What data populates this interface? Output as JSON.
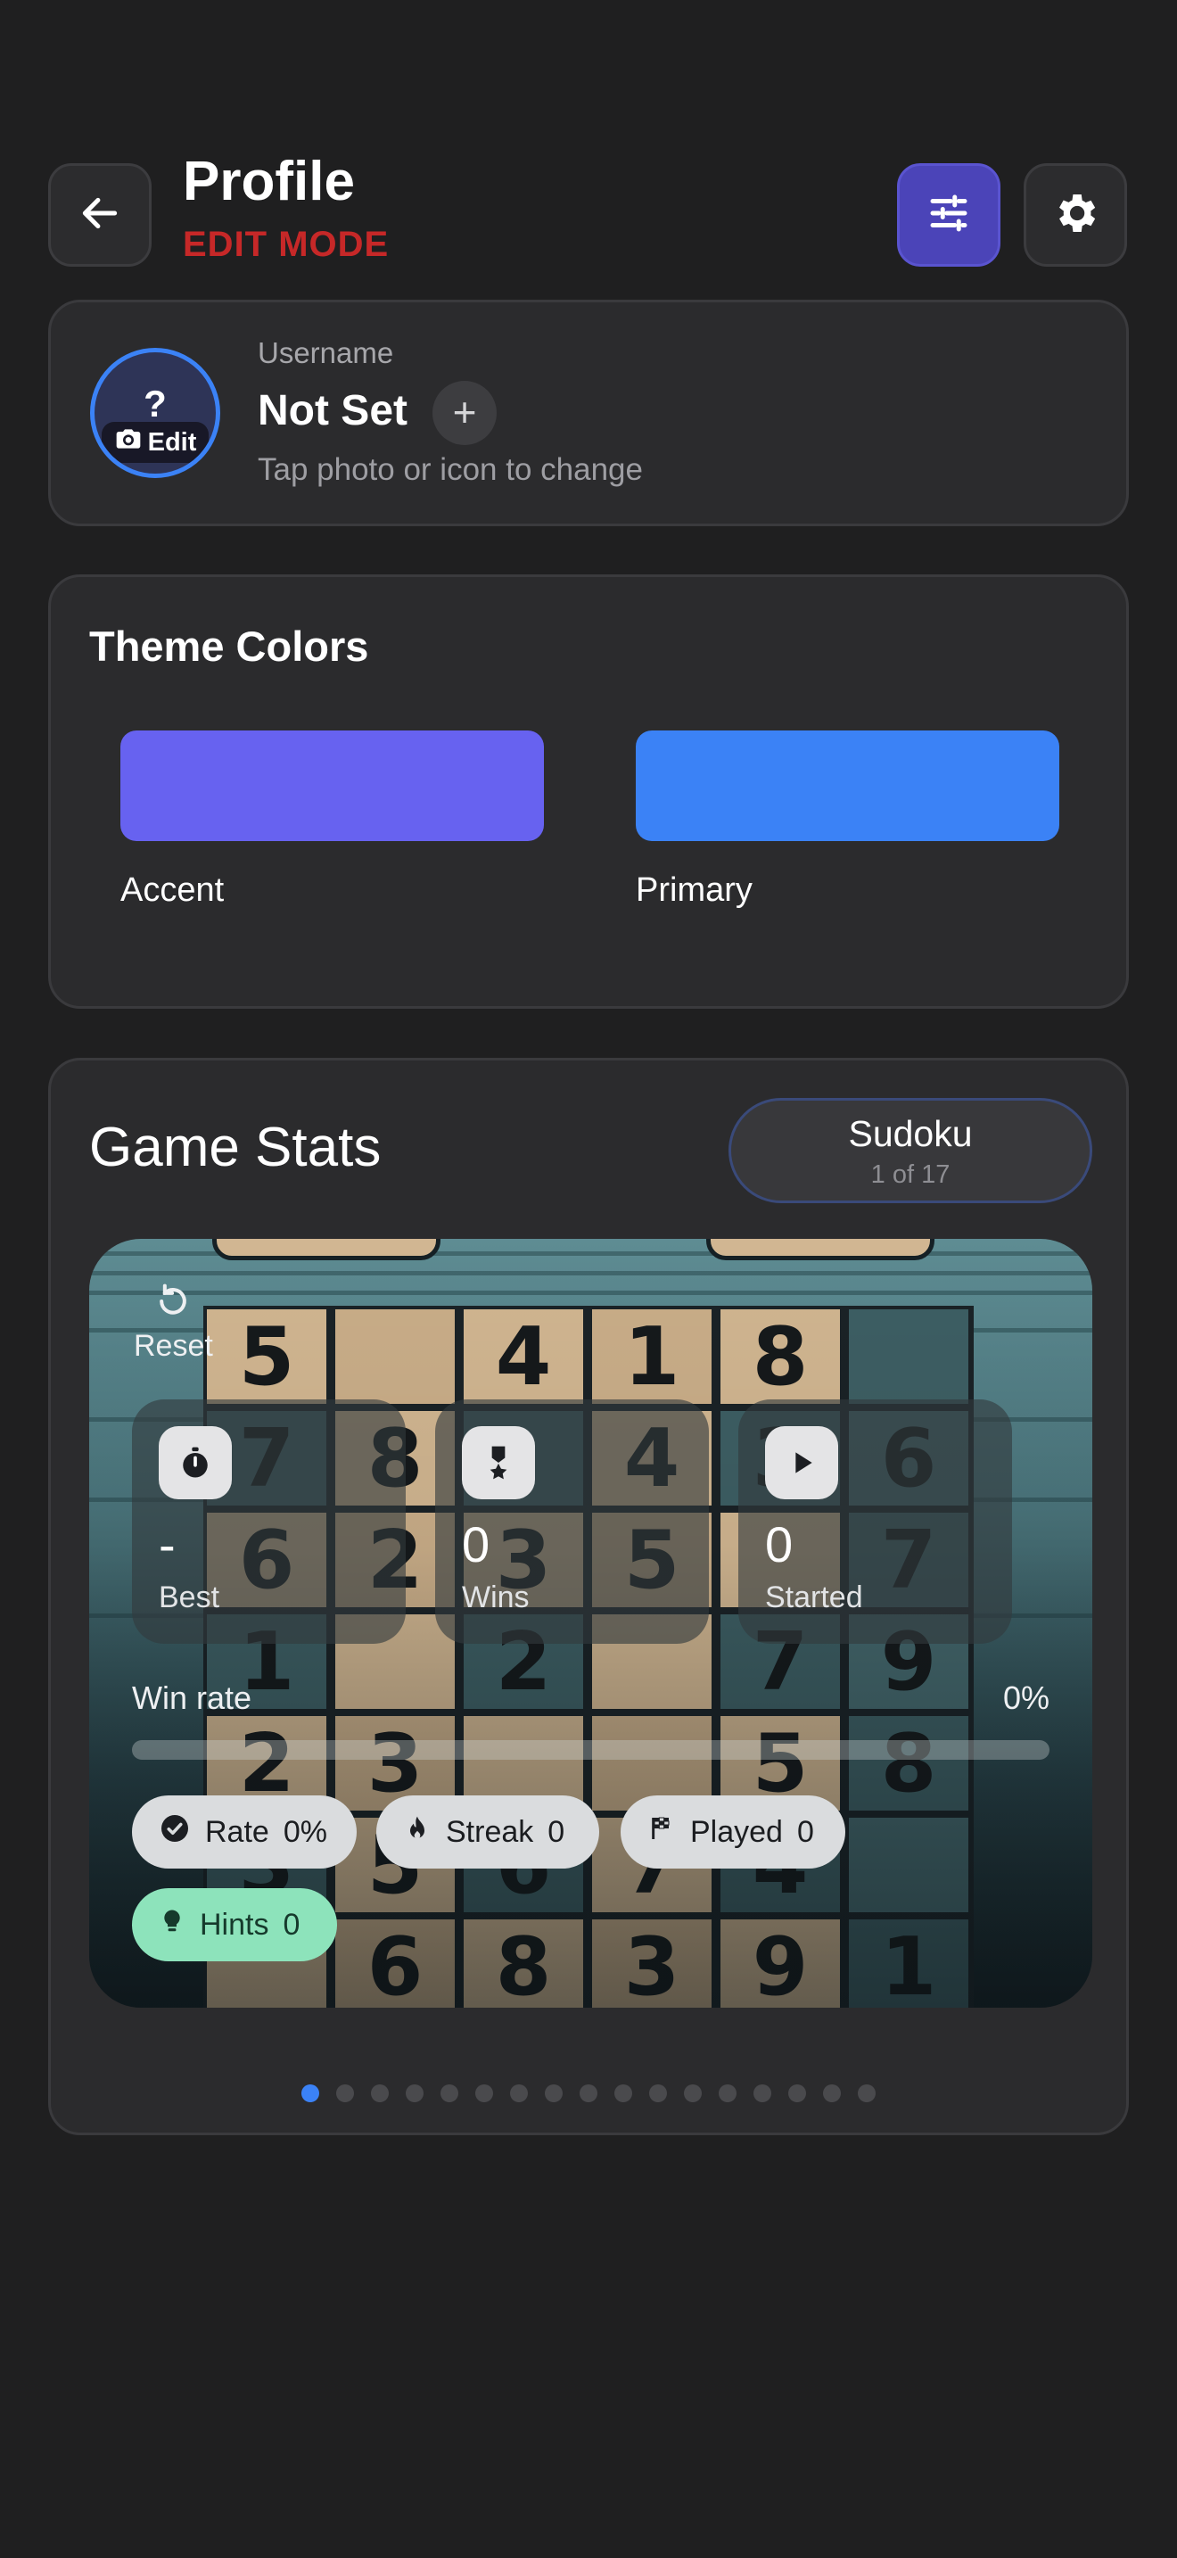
{
  "header": {
    "title": "Profile",
    "mode": "EDIT MODE",
    "back_icon": "arrow-left-icon",
    "tune_icon": "sliders-icon",
    "settings_icon": "gear-icon"
  },
  "profile": {
    "avatar_placeholder": "?",
    "avatar_edit_label": "Edit",
    "username_label": "Username",
    "username_value": "Not Set",
    "add_label": "+",
    "hint": "Tap photo or icon to change"
  },
  "theme": {
    "title": "Theme Colors",
    "swatches": [
      {
        "label": "Accent",
        "color": "#6762f0"
      },
      {
        "label": "Primary",
        "color": "#3b82f6"
      }
    ]
  },
  "game_stats": {
    "title": "Game Stats",
    "game_name": "Sudoku",
    "game_counter": "1 of 17",
    "reset_label": "Reset",
    "stats": [
      {
        "icon": "stopwatch-icon",
        "value": "-",
        "label": "Best"
      },
      {
        "icon": "medal-icon",
        "value": "0",
        "label": "Wins"
      },
      {
        "icon": "play-icon",
        "value": "0",
        "label": "Started"
      }
    ],
    "win_rate_label": "Win rate",
    "win_rate_value": "0%",
    "win_rate_fraction": 0,
    "chips": [
      {
        "icon": "check-circle-icon",
        "label": "Rate",
        "value": "0%"
      },
      {
        "icon": "flame-icon",
        "label": "Streak",
        "value": "0"
      },
      {
        "icon": "flag-icon",
        "label": "Played",
        "value": "0"
      },
      {
        "icon": "lightbulb-icon",
        "label": "Hints",
        "value": "0"
      }
    ],
    "board_rows": [
      [
        "5",
        "",
        "4",
        "1",
        "8",
        ""
      ],
      [
        "7",
        "8",
        "",
        "4",
        "3",
        "6"
      ],
      [
        "6",
        "2",
        "3",
        "5",
        "",
        "7"
      ],
      [
        "1",
        "",
        "2",
        "",
        "7",
        "9"
      ],
      [
        "2",
        "3",
        "",
        "",
        "5",
        "8"
      ],
      [
        "3",
        "5",
        "6",
        "7",
        "4",
        ""
      ],
      [
        "",
        "6",
        "8",
        "3",
        "9",
        "1"
      ]
    ],
    "page_count": 17,
    "active_page": 0
  }
}
